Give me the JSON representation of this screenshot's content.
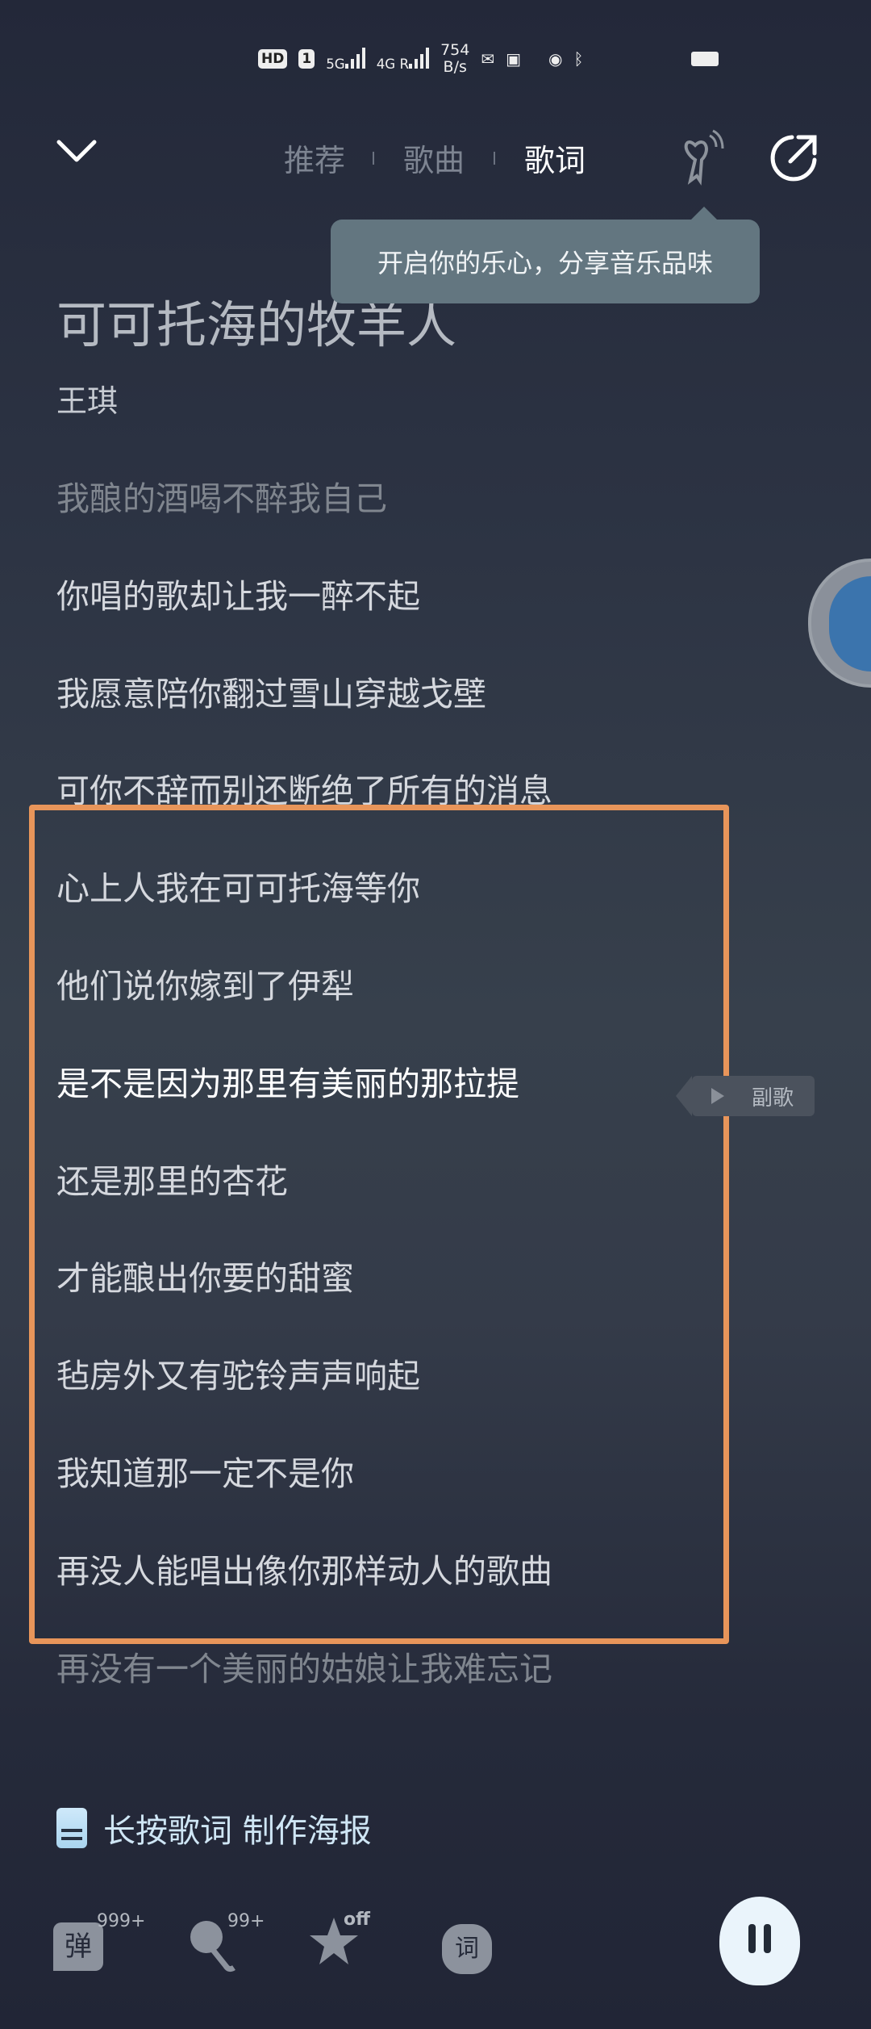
{
  "status_bar": {
    "hd": "HD",
    "sim": "1",
    "net1": "5G",
    "net2": "4G R",
    "speed_value": "754",
    "speed_unit": "B/s"
  },
  "nav": {
    "tabs": [
      {
        "label": "推荐"
      },
      {
        "label": "歌曲"
      },
      {
        "label": "歌词",
        "active": true
      }
    ]
  },
  "tooltip": "开启你的乐心，分享音乐品味",
  "song": {
    "title": "可可托海的牧羊人",
    "artist": "王琪"
  },
  "lyrics": [
    "我酿的酒喝不醉我自己",
    "你唱的歌却让我一醉不起",
    "我愿意陪你翻过雪山穿越戈壁",
    "可你不辞而别还断绝了所有的消息",
    "心上人我在可可托海等你",
    "他们说你嫁到了伊犁",
    "是不是因为那里有美丽的那拉提",
    "还是那里的杏花",
    "才能酿出你要的甜蜜",
    "毡房外又有驼铃声声响起",
    "我知道那一定不是你",
    "再没人能唱出像你那样动人的歌曲",
    "再没有一个美丽的姑娘让我难忘记"
  ],
  "current_line_index": 6,
  "chorus_tag": "副歌",
  "highlight_color": "#e8955a",
  "poster_hint": "长按歌词 制作海报",
  "bottom": {
    "danmaku_label": "弹",
    "danmaku_count": "999+",
    "karaoke_count": "99+",
    "effect_state": "off",
    "lyric_label": "词"
  }
}
